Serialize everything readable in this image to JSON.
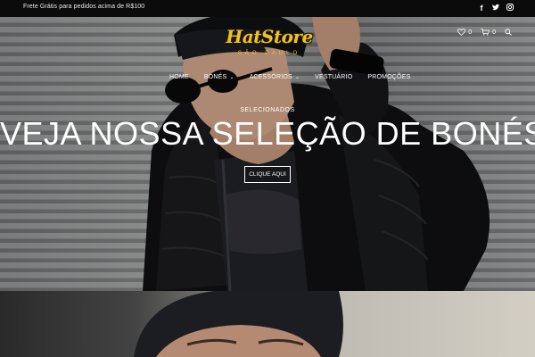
{
  "topbar": {
    "promo_text": "Frete Grátis para pedidos acima de R$100",
    "social": [
      {
        "icon": "facebook-icon",
        "glyph": "f"
      },
      {
        "icon": "twitter-icon",
        "glyph": "🐦"
      },
      {
        "icon": "instagram-icon",
        "glyph": "◎"
      }
    ]
  },
  "header": {
    "logo_title": "HatStore",
    "logo_subtitle": "SÃO PAULO",
    "wishlist_count": "0",
    "cart_count": "0"
  },
  "nav": {
    "items": [
      {
        "label": "HOME",
        "has_dropdown": false
      },
      {
        "label": "BONÉS",
        "has_dropdown": true
      },
      {
        "label": "ACESSÓRIOS",
        "has_dropdown": true
      },
      {
        "label": "VESTUÁRIO",
        "has_dropdown": false
      },
      {
        "label": "PROMOÇÕES",
        "has_dropdown": false
      }
    ]
  },
  "hero": {
    "kicker": "SELECIONADOS",
    "title": "VEJA NOSSA SELEÇÃO DE BONÉS",
    "button_label": "CLIQUE AQUI"
  },
  "colors": {
    "logo_yellow": "#f4c21b",
    "topbar_bg": "#0b0b0b"
  }
}
